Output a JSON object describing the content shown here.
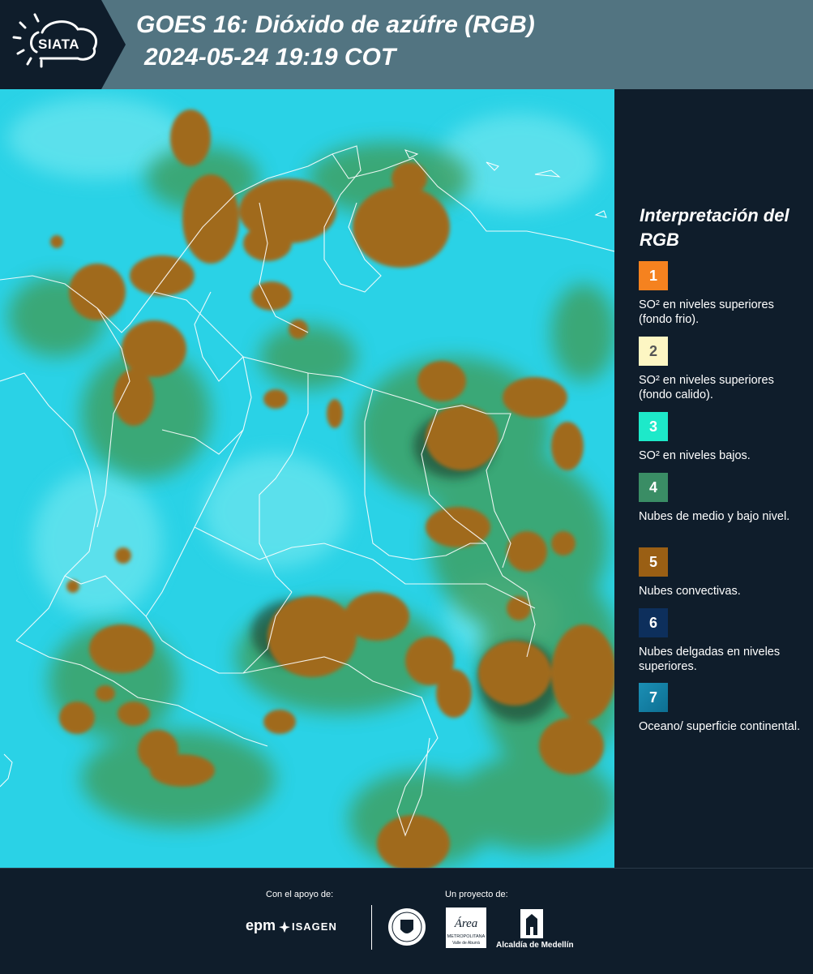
{
  "header": {
    "logo": "SIATA",
    "title_line1": "GOES 16: Dióxido de azúfre (RGB)",
    "title_line2": "2024-05-24 19:19 COT"
  },
  "legend": {
    "title": "Interpretación del RGB",
    "items": [
      {
        "num": "1",
        "color": "#f5821f",
        "text": "SO² en niveles superiores (fondo frio)."
      },
      {
        "num": "2",
        "color": "#fdf6c3",
        "text": "SO² en niveles superiores (fondo calido)."
      },
      {
        "num": "3",
        "color": "#1de9c9",
        "text": "SO² en niveles bajos."
      },
      {
        "num": "4",
        "color": "#3a8d65",
        "text": "Nubes de medio y bajo nivel."
      },
      {
        "num": "5",
        "color": "#9a5f14",
        "text": "Nubes convectivas."
      },
      {
        "num": "6",
        "color": "#0d2f5c",
        "text": "Nubes delgadas en niveles superiores."
      },
      {
        "num": "7",
        "color": "#1b8fb5",
        "text": "Oceano/ superficie continental."
      }
    ]
  },
  "footer": {
    "support_label": "Con el apoyo de:",
    "project_label": "Un proyecto de:",
    "epm": "epm",
    "isagen": "ISAGEN",
    "area_metro": "Área",
    "area_metro_sub": "METROPOLITANA",
    "area_metro_sub2": "Valle de Aburrá",
    "alcaldia": "Alcaldía de Medellín"
  },
  "colors": {
    "header_bg": "#527481",
    "dark_bg": "#0f1d2b",
    "ocean": "#2ad2e6",
    "cloud": "#a06a1c",
    "mid_cloud": "#3d9a5a"
  }
}
